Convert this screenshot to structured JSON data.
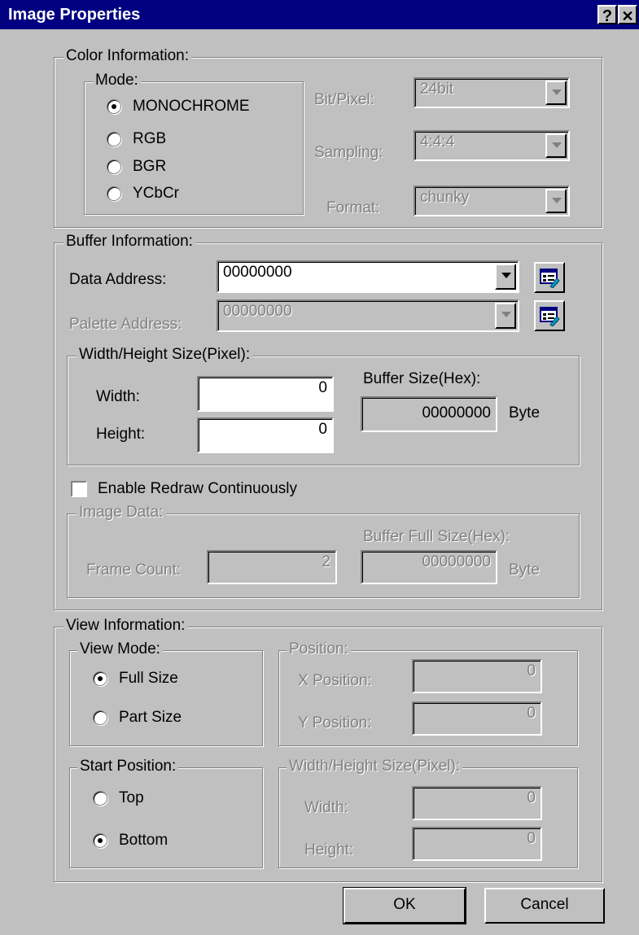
{
  "window": {
    "title": "Image Properties",
    "help_glyph": "?",
    "close_glyph": "✕"
  },
  "color_info": {
    "legend": "Color Information:",
    "mode_legend": "Mode:",
    "modes": [
      "MONOCHROME",
      "RGB",
      "BGR",
      "YCbCr"
    ],
    "selected_mode": "MONOCHROME",
    "bit_pixel": {
      "label": "Bit/Pixel:",
      "value": "24bit"
    },
    "sampling": {
      "label": "Sampling:",
      "value": "4:4:4"
    },
    "format": {
      "label": "Format:",
      "value": "chunky"
    }
  },
  "buffer_info": {
    "legend": "Buffer Information:",
    "data_address": {
      "label": "Data Address:",
      "value": "00000000"
    },
    "palette_address": {
      "label": "Palette Address:",
      "value": "00000000"
    },
    "size_legend": "Width/Height Size(Pixel):",
    "width": {
      "label": "Width:",
      "value": "0"
    },
    "height": {
      "label": "Height:",
      "value": "0"
    },
    "buffer_size": {
      "label": "Buffer Size(Hex):",
      "value": "00000000",
      "unit": "Byte"
    },
    "enable_redraw": {
      "label": "Enable Redraw Continuously",
      "checked": false
    },
    "image_data": {
      "legend": "Image Data:",
      "frame_count": {
        "label": "Frame Count:",
        "value": "2"
      },
      "buffer_full_size": {
        "label": "Buffer Full Size(Hex):",
        "value": "00000000",
        "unit": "Byte"
      }
    }
  },
  "view_info": {
    "legend": "View Information:",
    "view_mode_legend": "View Mode:",
    "view_modes": [
      "Full Size",
      "Part Size"
    ],
    "selected_view_mode": "Full Size",
    "position_legend": "Position:",
    "x_position": {
      "label": "X Position:",
      "value": "0"
    },
    "y_position": {
      "label": "Y Position:",
      "value": "0"
    },
    "start_legend": "Start Position:",
    "start_positions": [
      "Top",
      "Bottom"
    ],
    "selected_start": "Bottom",
    "size_legend": "Width/Height Size(Pixel):",
    "width": {
      "label": "Width:",
      "value": "0"
    },
    "height": {
      "label": "Height:",
      "value": "0"
    }
  },
  "buttons": {
    "ok": "OK",
    "cancel": "Cancel"
  },
  "icons": {
    "pick_address": "properties-tag-icon"
  },
  "colors": {
    "titlebar": "#000080",
    "face": "#c0c0c0",
    "disabled_text": "#808080"
  }
}
